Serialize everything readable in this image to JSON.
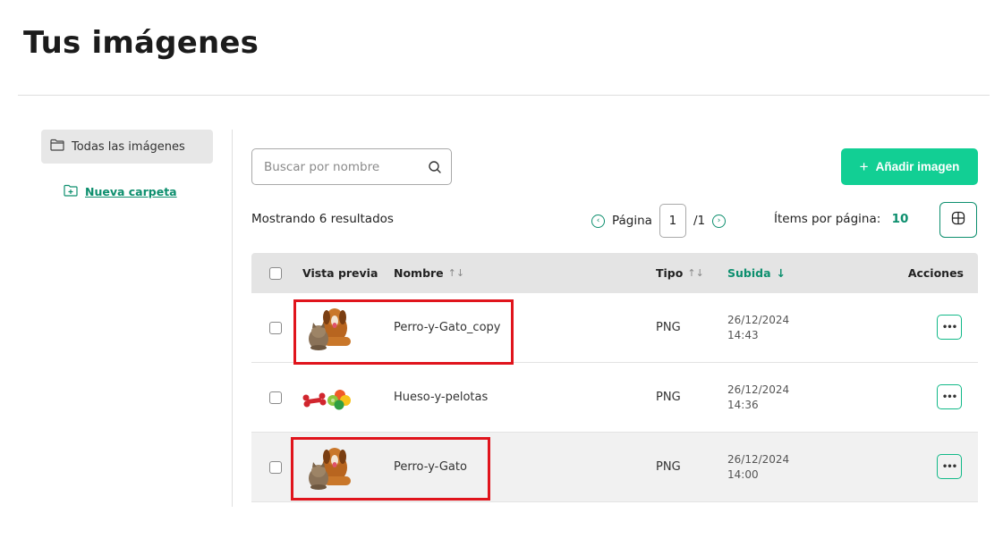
{
  "page": {
    "title": "Tus imágenes"
  },
  "sidebar": {
    "all_images_label": "Todas las imágenes",
    "new_folder_label": "Nueva carpeta"
  },
  "toolbar": {
    "search_placeholder": "Buscar por nombre",
    "add_button_label": "Añadir imagen",
    "results_text": "Mostrando 6 resultados",
    "page_label": "Página",
    "current_page": "1",
    "total_pages": "/1",
    "items_per_page_label": "Ítems por página:",
    "items_per_page_value": "10"
  },
  "table": {
    "headers": {
      "preview": "Vista previa",
      "name": "Nombre",
      "type": "Tipo",
      "uploaded": "Subida",
      "actions": "Acciones"
    },
    "rows": [
      {
        "name": "Perro-y-Gato_copy",
        "type": "PNG",
        "date": "26/12/2024",
        "time": "14:43",
        "thumbnail": "dog-and-cat",
        "highlighted": true
      },
      {
        "name": "Hueso-y-pelotas",
        "type": "PNG",
        "date": "26/12/2024",
        "time": "14:36",
        "thumbnail": "bone-and-balls",
        "highlighted": false
      },
      {
        "name": "Perro-y-Gato",
        "type": "PNG",
        "date": "26/12/2024",
        "time": "14:00",
        "thumbnail": "dog-and-cat",
        "highlighted": true
      }
    ]
  },
  "colors": {
    "accent": "#12cf94",
    "accent_dark": "#0d8f6e",
    "highlight_box": "#e0141c",
    "header_bg": "#e4e4e4"
  }
}
